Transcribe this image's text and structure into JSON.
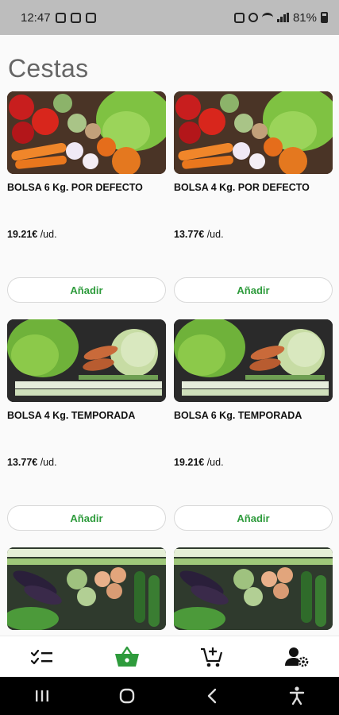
{
  "status_bar": {
    "time": "12:47",
    "battery": "81%"
  },
  "page_title": "Cestas",
  "products": [
    {
      "name": "BOLSA 6 Kg. POR DEFECTO",
      "price": "19.21€",
      "unit": " /ud.",
      "button": "Añadir"
    },
    {
      "name": "BOLSA 4 Kg. POR DEFECTO",
      "price": "13.77€",
      "unit": " /ud.",
      "button": "Añadir"
    },
    {
      "name": "BOLSA 4 Kg. TEMPORADA",
      "price": "13.77€",
      "unit": " /ud.",
      "button": "Añadir"
    },
    {
      "name": "BOLSA 6 Kg. TEMPORADA",
      "price": "19.21€",
      "unit": " /ud.",
      "button": "Añadir"
    }
  ],
  "bottom_nav": [
    {
      "icon": "checklist-icon",
      "active": false
    },
    {
      "icon": "basket-icon",
      "active": true
    },
    {
      "icon": "add-to-cart-icon",
      "active": false
    },
    {
      "icon": "user-settings-icon",
      "active": false
    }
  ],
  "colors": {
    "accent": "#2e9b3c",
    "title": "#666666",
    "status_bar": "#bdbdbd"
  }
}
